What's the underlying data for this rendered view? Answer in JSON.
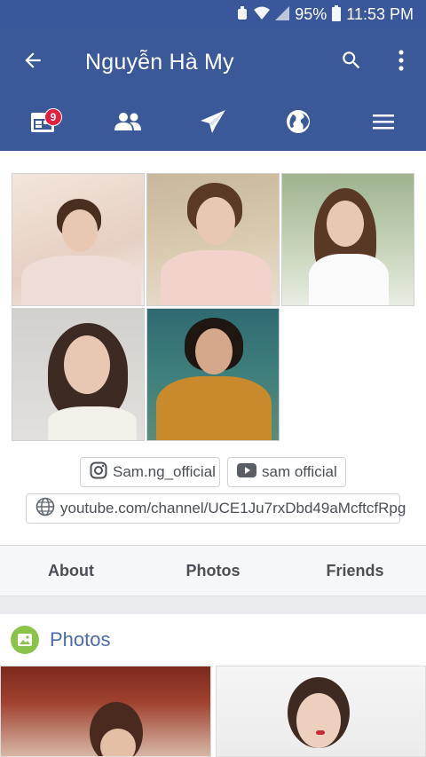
{
  "status_bar": {
    "battery": "95%",
    "time": "11:53 PM",
    "icons": [
      "alarm-icon",
      "wifi-icon",
      "signal-icon",
      "battery-icon"
    ]
  },
  "app_bar": {
    "title": "Nguyễn Hà My",
    "back_icon": "arrow-left-icon",
    "search_icon": "search-icon",
    "overflow_icon": "more-vert-icon"
  },
  "tabs": [
    {
      "name": "events-icon",
      "badge": "9"
    },
    {
      "name": "friends-icon"
    },
    {
      "name": "messenger-icon"
    },
    {
      "name": "globe-icon"
    },
    {
      "name": "menu-icon"
    }
  ],
  "links": {
    "instagram": "Sam.ng_official",
    "youtube": "sam official",
    "website": "youtube.com/channel/UCE1Ju7rxDbd49aMcftcfRpg"
  },
  "section_tabs": {
    "about": "About",
    "photos": "Photos",
    "friends": "Friends"
  },
  "photos_section": {
    "title": "Photos"
  },
  "colors": {
    "brand": "#3b5998",
    "badge": "#e41e3f",
    "photos_icon_bg": "#8bc34a"
  }
}
